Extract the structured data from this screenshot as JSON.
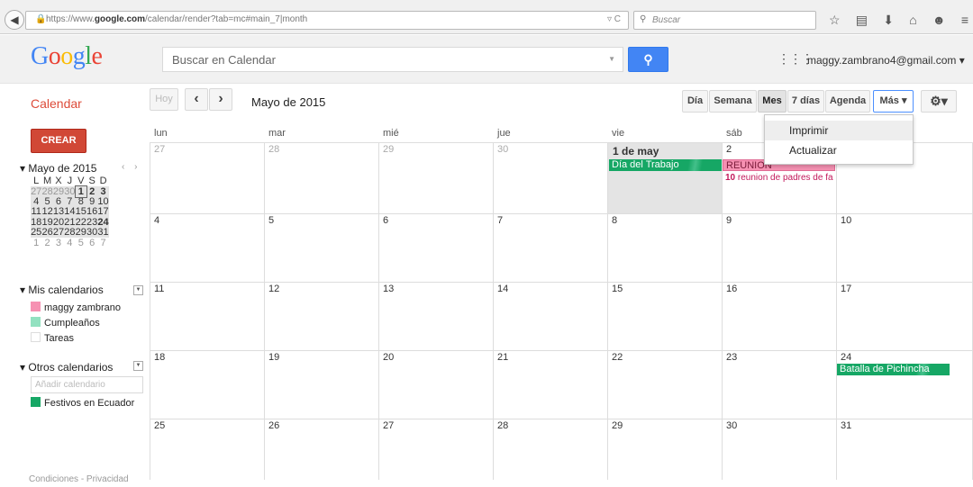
{
  "browser": {
    "url_prefix": "https://www.",
    "url_domain": "google.com",
    "url_rest": "/calendar/render?tab=mc#main_7|month",
    "search_placeholder": "Buscar"
  },
  "header": {
    "logo": "Google",
    "search_placeholder": "Buscar en Calendar",
    "account": "maggy.zambrano4@gmail.com ▾"
  },
  "toolbar": {
    "app_name": "Calendar",
    "today": "Hoy",
    "prev": "‹",
    "next": "›",
    "date_range": "Mayo de 2015",
    "views": [
      "Día",
      "Semana",
      "Mes",
      "7 días",
      "Agenda"
    ],
    "more": "Más ▾",
    "selected_view": "Mes"
  },
  "more_menu": {
    "items": [
      "Imprimir",
      "Actualizar"
    ]
  },
  "sidebar": {
    "create": "CREAR",
    "mini_title": "Mayo de 2015",
    "mini_nav": "‹ ›",
    "mini_days": [
      "L",
      "M",
      "X",
      "J",
      "V",
      "S",
      "D"
    ],
    "mini_weeks": [
      [
        "27",
        "28",
        "29",
        "30",
        "1",
        "2",
        "3"
      ],
      [
        "4",
        "5",
        "6",
        "7",
        "8",
        "9",
        "10"
      ],
      [
        "11",
        "12",
        "13",
        "14",
        "15",
        "16",
        "17"
      ],
      [
        "18",
        "19",
        "20",
        "21",
        "22",
        "23",
        "24"
      ],
      [
        "25",
        "26",
        "27",
        "28",
        "29",
        "30",
        "31"
      ],
      [
        "1",
        "2",
        "3",
        "4",
        "5",
        "6",
        "7"
      ]
    ],
    "my_calendars_title": "Mis calendarios",
    "my_calendars": [
      {
        "name": "maggy zambrano",
        "color": "#f691b2"
      },
      {
        "name": "Cumpleaños",
        "color": "#92e1c0"
      },
      {
        "name": "Tareas",
        "color": "#ffffff"
      }
    ],
    "other_calendars_title": "Otros calendarios",
    "add_calendar_placeholder": "Añadir calendario",
    "other_calendars": [
      {
        "name": "Festivos en Ecuador",
        "color": "#16a765"
      }
    ],
    "footer": "Condiciones - Privacidad"
  },
  "grid": {
    "day_names": [
      "lun",
      "mar",
      "mié",
      "jue",
      "vie",
      "sáb",
      "dom"
    ],
    "weeks": [
      [
        "27",
        "28",
        "29",
        "30",
        "1 de may",
        "2",
        "3"
      ],
      [
        "4",
        "5",
        "6",
        "7",
        "8",
        "9",
        "10"
      ],
      [
        "11",
        "12",
        "13",
        "14",
        "15",
        "16",
        "17"
      ],
      [
        "18",
        "19",
        "20",
        "21",
        "22",
        "23",
        "24"
      ],
      [
        "25",
        "26",
        "27",
        "28",
        "29",
        "30",
        "31"
      ]
    ],
    "events": {
      "dia_trabajo": "Día del Trabajo",
      "reunion": "REUNION",
      "padres_time": "10",
      "padres_title": " reunion de padres de fa",
      "pichincha": "Batalla de Pichincha"
    }
  }
}
